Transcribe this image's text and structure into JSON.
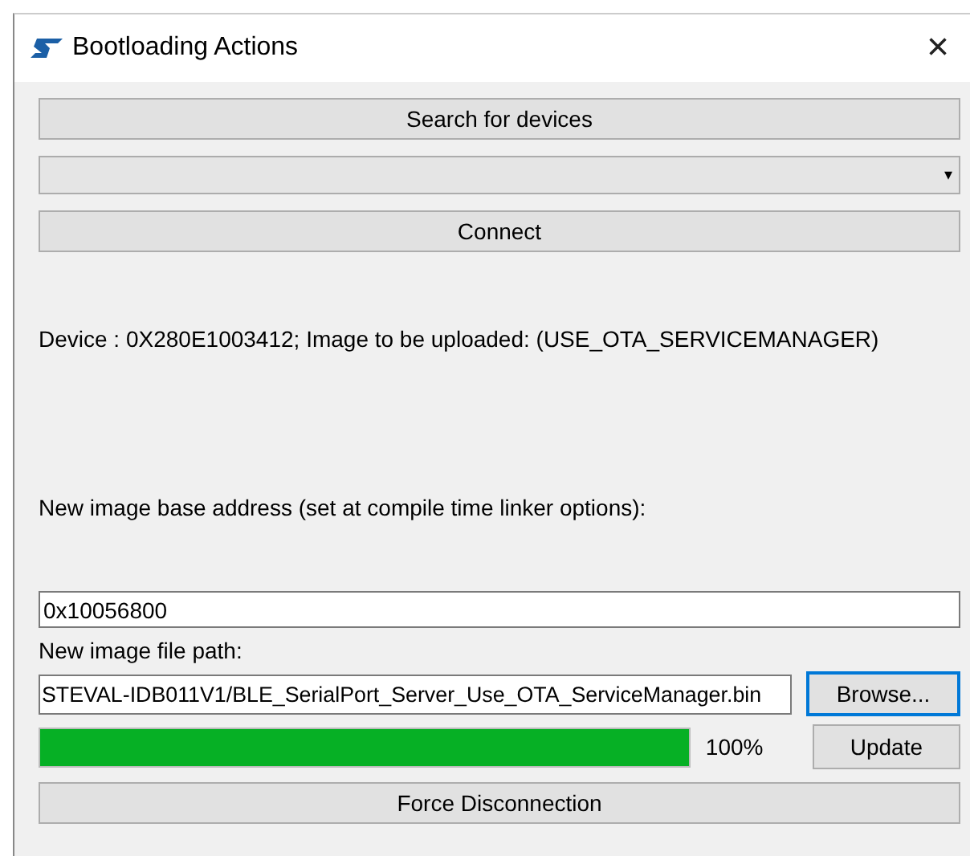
{
  "window": {
    "title": "Bootloading Actions",
    "close": "×"
  },
  "search_button": {
    "label": "Search for devices"
  },
  "device_dropdown": {
    "arrow": "▾"
  },
  "connect_button": {
    "label": "Connect"
  },
  "device_info": "Device : 0X280E1003412; Image to be uploaded: (USE_OTA_SERVICEMANAGER)",
  "base_address": {
    "label": "New image base address (set at compile time linker options):",
    "value": "0x10056800"
  },
  "file_path": {
    "label": "New image file path:",
    "value": "STEVAL-IDB011V1/BLE_SerialPort_Server_Use_OTA_ServiceManager.bin"
  },
  "browse_button": {
    "label": "Browse...",
    "focused": true
  },
  "progress": {
    "level": 1,
    "reading": "100%"
  },
  "update_button": {
    "label": "Update"
  },
  "disconnect_button": {
    "label": "Force Disconnection"
  }
}
